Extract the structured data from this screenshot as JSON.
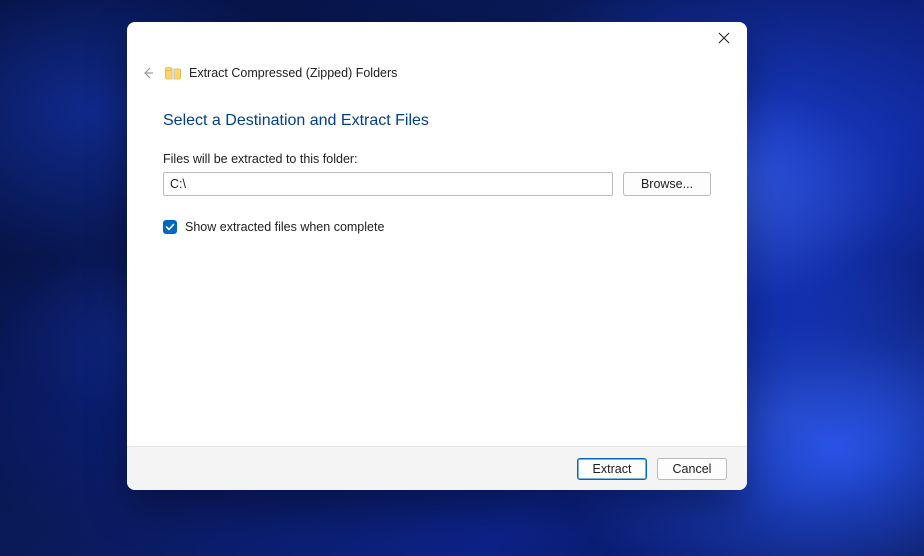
{
  "dialog": {
    "title": "Extract Compressed (Zipped) Folders",
    "heading": "Select a Destination and Extract Files",
    "path_label": "Files will be extracted to this folder:",
    "path_value": "C:\\",
    "browse_label": "Browse...",
    "checkbox_label": "Show extracted files when complete",
    "checkbox_checked": true,
    "extract_label": "Extract",
    "cancel_label": "Cancel"
  }
}
